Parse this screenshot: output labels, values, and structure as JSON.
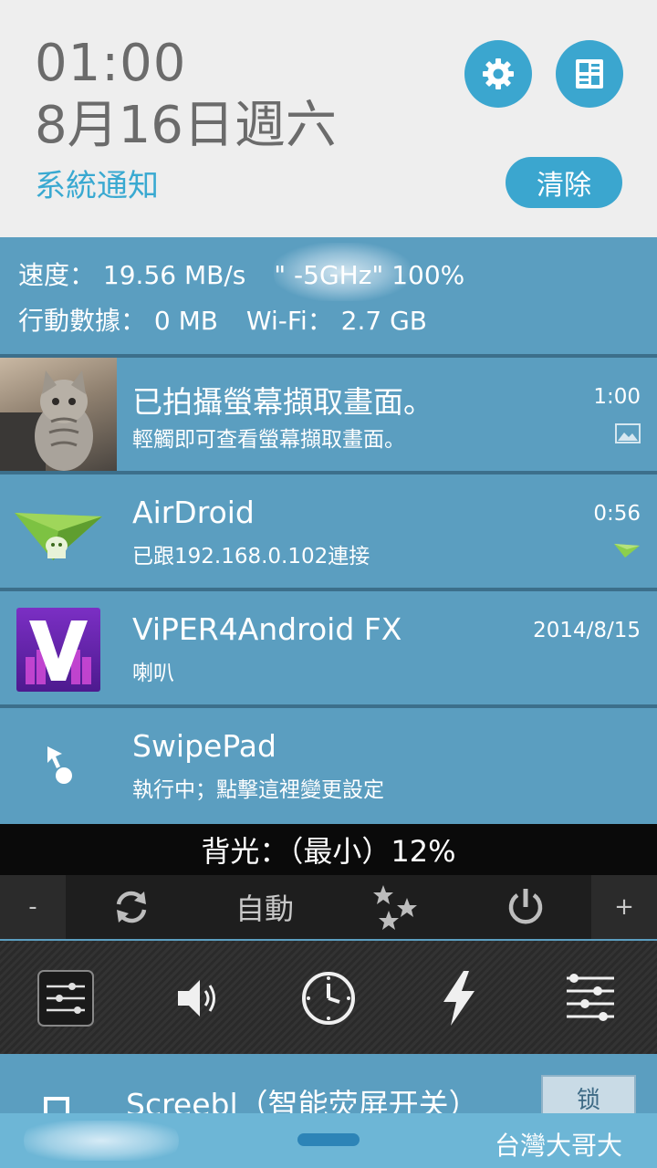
{
  "header": {
    "time": "01:00",
    "date": "8月16日週六",
    "section_title": "系統通知",
    "clear_label": "清除"
  },
  "stats": {
    "speed_label": "速度：",
    "speed_value": "19.56 MB/s",
    "network": "\"          -5GHz\" 100%",
    "mobile_label": "行動數據：",
    "mobile_value": "0 MB",
    "wifi_label": "Wi-Fi：",
    "wifi_value": "2.7 GB"
  },
  "notifications": [
    {
      "title": "已拍攝螢幕擷取畫面。",
      "text": "輕觸即可查看螢幕擷取畫面。",
      "time": "1:00",
      "icon": "cat-photo"
    },
    {
      "title": "AirDroid",
      "text": "已跟192.168.0.102連接",
      "time": "0:56",
      "icon": "airdroid-plane"
    },
    {
      "title": "ViPER4Android FX",
      "text": "喇叭",
      "time": "2014/8/15",
      "icon": "viper-logo"
    },
    {
      "title": "SwipePad",
      "text": "執行中；點擊這裡變更設定",
      "time": "",
      "icon": "swipepad-pointer"
    }
  ],
  "backlight": {
    "label": "背光：（最小）12%",
    "minus": "-",
    "plus": "+",
    "auto_label": "自動"
  },
  "screebl": {
    "title": "Screebl（智能荧屏开关）",
    "lock_label": "锁"
  },
  "footer": {
    "carrier": "台灣大哥大"
  },
  "colors": {
    "accent": "#3ba6cf",
    "panel": "#5b9ec0",
    "header_bg": "#eeeeee"
  }
}
